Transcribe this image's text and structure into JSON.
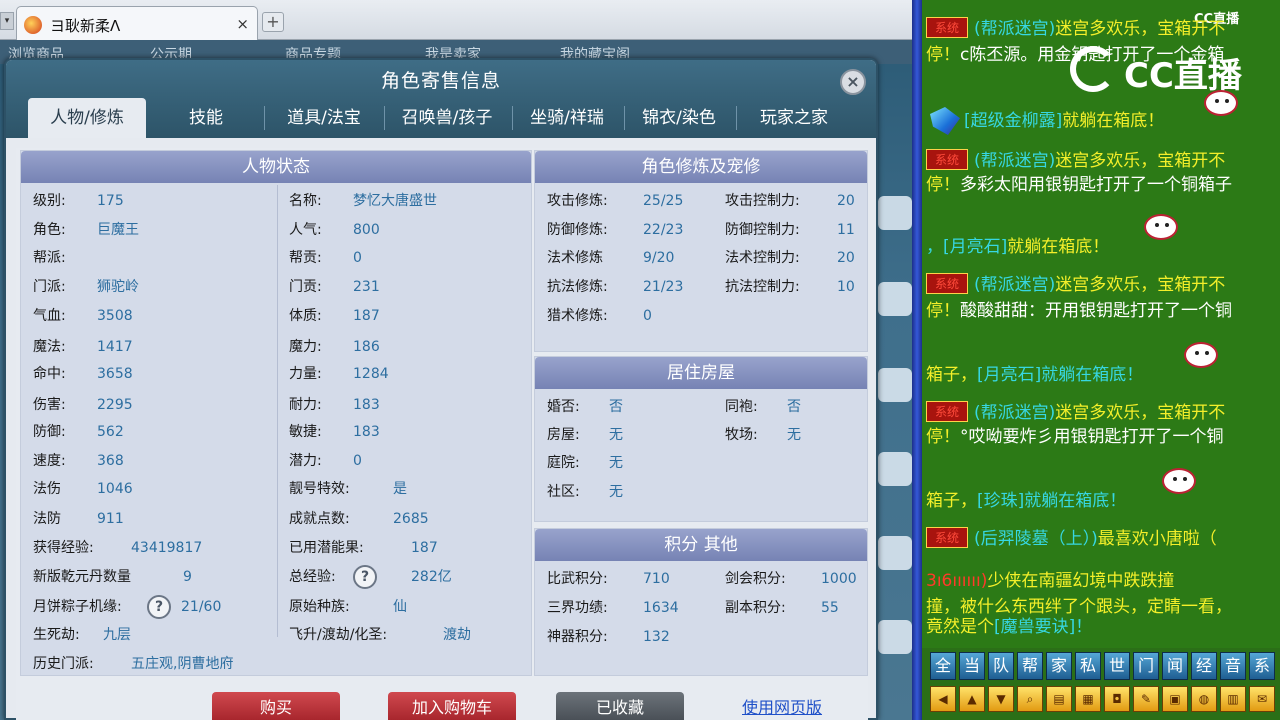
{
  "browser": {
    "tab_title": "ヨ耿新柔Λ",
    "new_tab_label": "+",
    "close_label": "×"
  },
  "background_nav": [
    "浏览商品",
    "公示期",
    "商品专题",
    "我是卖家",
    "我的藏宝阁"
  ],
  "dialog": {
    "title": "角色寄售信息",
    "close_label": "×",
    "tabs": [
      "人物/修炼",
      "技能",
      "道具/法宝",
      "召唤兽/孩子",
      "坐骑/祥瑞",
      "锦衣/染色",
      "玩家之家"
    ],
    "active_tab": "人物/修炼"
  },
  "status": {
    "title": "人物状态",
    "left": [
      {
        "label": "级别:",
        "value": "175"
      },
      {
        "label": "角色:",
        "value": "巨魔王"
      },
      {
        "label": "帮派:",
        "value": ""
      },
      {
        "label": "门派:",
        "value": "狮驼岭"
      },
      {
        "label": "气血:",
        "value": "3508"
      },
      {
        "label": "魔法:",
        "value": "1417"
      },
      {
        "label": "命中:",
        "value": "3658"
      },
      {
        "label": "伤害:",
        "value": "2295"
      },
      {
        "label": "防御:",
        "value": "562"
      },
      {
        "label": "速度:",
        "value": "368"
      },
      {
        "label": "法伤",
        "value": "1046"
      },
      {
        "label": "法防",
        "value": "911"
      }
    ],
    "right": [
      {
        "label": "名称:",
        "value": "梦忆大唐盛世"
      },
      {
        "label": "人气:",
        "value": "800"
      },
      {
        "label": "帮贡:",
        "value": "0"
      },
      {
        "label": "门贡:",
        "value": "231"
      },
      {
        "label": "体质:",
        "value": "187"
      },
      {
        "label": "魔力:",
        "value": "186"
      },
      {
        "label": "力量:",
        "value": "1284"
      },
      {
        "label": "耐力:",
        "value": "183"
      },
      {
        "label": "敏捷:",
        "value": "183"
      },
      {
        "label": "潜力:",
        "value": "0"
      },
      {
        "label": "靓号特效:",
        "value": "是"
      },
      {
        "label": "成就点数:",
        "value": "2685"
      }
    ],
    "wide_left": [
      {
        "label": "获得经验:",
        "value": "43419817"
      },
      {
        "label": "新版乾元丹数量",
        "value": "9"
      },
      {
        "label": "月饼粽子机缘:",
        "value": "21/60",
        "help": "?"
      },
      {
        "label": "生死劫:",
        "value": "九层"
      },
      {
        "label": "历史门派:",
        "value": "五庄观,阴曹地府"
      }
    ],
    "wide_right": [
      {
        "label": "已用潜能果:",
        "value": "187"
      },
      {
        "label": "总经验:",
        "value": "282亿",
        "help": "?"
      },
      {
        "label": "原始种族:",
        "value": "仙"
      },
      {
        "label": "飞升/渡劫/化圣:",
        "value": "渡劫"
      }
    ]
  },
  "cultivation": {
    "title": "角色修炼及宠修",
    "left": [
      {
        "label": "攻击修炼:",
        "value": "25/25"
      },
      {
        "label": "防御修炼:",
        "value": "22/23"
      },
      {
        "label": "法术修炼",
        "value": "9/20"
      },
      {
        "label": "抗法修炼:",
        "value": "21/23"
      },
      {
        "label": "猎术修炼:",
        "value": "0"
      }
    ],
    "right": [
      {
        "label": "攻击控制力:",
        "value": "20"
      },
      {
        "label": "防御控制力:",
        "value": "11"
      },
      {
        "label": "法术控制力:",
        "value": "20"
      },
      {
        "label": "抗法控制力:",
        "value": "10"
      }
    ]
  },
  "housing": {
    "title": "居住房屋",
    "left": [
      {
        "label": "婚否:",
        "value": "否"
      },
      {
        "label": "房屋:",
        "value": "无"
      },
      {
        "label": "庭院:",
        "value": "无"
      },
      {
        "label": "社区:",
        "value": "无"
      }
    ],
    "right": [
      {
        "label": "同袍:",
        "value": "否"
      },
      {
        "label": "牧场:",
        "value": "无"
      }
    ]
  },
  "points": {
    "title": "积分 其他",
    "left": [
      {
        "label": "比武积分:",
        "value": "710"
      },
      {
        "label": "三界功绩:",
        "value": "1634"
      },
      {
        "label": "神器积分:",
        "value": "132"
      }
    ],
    "right": [
      {
        "label": "剑会积分:",
        "value": "1000"
      },
      {
        "label": "副本积分:",
        "value": "55"
      }
    ]
  },
  "actions": {
    "buy": "购买",
    "add_cart": "加入购物车",
    "collected": "已收藏",
    "web_version": "使用网页版"
  },
  "chat": {
    "logo_text": "CC直播",
    "logo_small": "CC直播",
    "system_badge": "系统",
    "lines": [
      {
        "a": "(帮派迷宫)",
        "b": "迷宫多欢乐，宝箱开不"
      },
      {
        "a": "停！",
        "b": "c陈丕源。用金钥匙打开了一个金箱"
      },
      {
        "a": "[超级金柳露]",
        "b": "就躺在箱底！"
      },
      {
        "a": "(帮派迷宫)",
        "b": "迷宫多欢乐，宝箱开不"
      },
      {
        "a": "停！",
        "b": "多彩太阳用银钥匙打开了一个铜箱子"
      },
      {
        "a": "，[月亮石]",
        "b": "就躺在箱底！"
      },
      {
        "a": "(帮派迷宫)",
        "b": "迷宫多欢乐，宝箱开不"
      },
      {
        "a": "停！",
        "b": "酸酸甜甜：开用银钥匙打开了一个铜"
      },
      {
        "a": "箱子，",
        "b": "[月亮石]就躺在箱底！"
      },
      {
        "a": "(帮派迷宫)",
        "b": "迷宫多欢乐，宝箱开不"
      },
      {
        "a": "停！",
        "b": "°哎呦要炸彡用银钥匙打开了一个铜"
      },
      {
        "a": "箱子，",
        "b": "[珍珠]就躺在箱底！"
      },
      {
        "a": "(后羿陵墓（上）)",
        "b": "最喜欢小唐啦（"
      },
      {
        "a": "3ı6ıııııı)",
        "b": "少侠在南疆幻境中跌跌撞"
      },
      {
        "a": "撞，被什么东西绊了个跟头，定睛一看，",
        "b": ""
      },
      {
        "a": "竟然是个",
        "b": "[魔兽要诀]！"
      }
    ],
    "toolbar_row1": [
      "全",
      "当",
      "队",
      "帮",
      "家",
      "私",
      "世",
      "门",
      "闻",
      "经",
      "音",
      "系"
    ],
    "toolbar_row2_icons": [
      "arrow-left-icon",
      "arrow-up-icon",
      "arrow-down-icon",
      "magnify-icon",
      "note-icon",
      "grid-icon",
      "lock-icon",
      "brush-icon",
      "window-icon",
      "chat-bubble-icon",
      "book-icon",
      "mail-icon"
    ]
  },
  "colors": {
    "dialog_header": "#2d5468",
    "section_header": "#7683b4",
    "value_text": "#2d6ea0",
    "buy_button": "#a8262d",
    "chat_bg": "#2c7a16",
    "chat_yellow": "#f4ef2a",
    "chat_cyan": "#37d7e2"
  }
}
